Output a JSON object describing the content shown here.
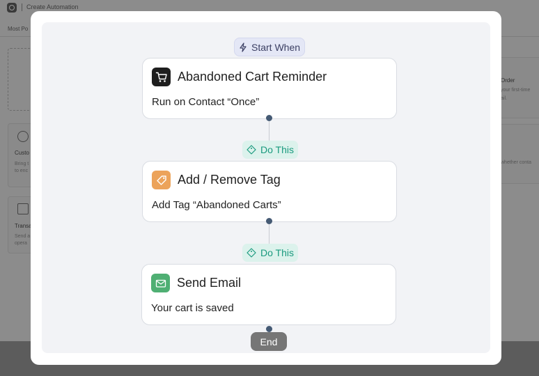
{
  "background": {
    "breadcrumb": "Create Automation",
    "tab_label": "Most Po",
    "cards": [
      {
        "title": "Custo",
        "desc_1": "Bring t",
        "desc_2": "to enc"
      },
      {
        "title": "Transa",
        "desc_1": "Send a",
        "desc_2": "opera"
      }
    ],
    "right_cards": [
      {
        "title": "Order",
        "desc_1": "your first-time",
        "desc_2": "ail."
      },
      {
        "desc_1": "whether conta"
      }
    ]
  },
  "flow": {
    "start_label": "Start When",
    "trigger": {
      "title": "Abandoned Cart Reminder",
      "subtitle": "Run on Contact “Once”",
      "icon": "cart-icon",
      "icon_bg": "#1e1e1e"
    },
    "step_label_1": "Do This",
    "action_tag": {
      "title": "Add / Remove Tag",
      "subtitle": "Add Tag “Abandoned Carts”",
      "icon": "tag-icon",
      "icon_bg": "#eca35a"
    },
    "step_label_2": "Do This",
    "action_email": {
      "title": "Send Email",
      "subtitle": "Your cart is saved",
      "icon": "envelope-icon",
      "icon_bg": "#4faf73"
    },
    "end_label": "End"
  },
  "colors": {
    "step_pill_bg": "#dcf2ec",
    "step_pill_text": "#1a9a7e",
    "start_pill_bg": "#e4e7f6",
    "connector_dot": "#455a74"
  }
}
